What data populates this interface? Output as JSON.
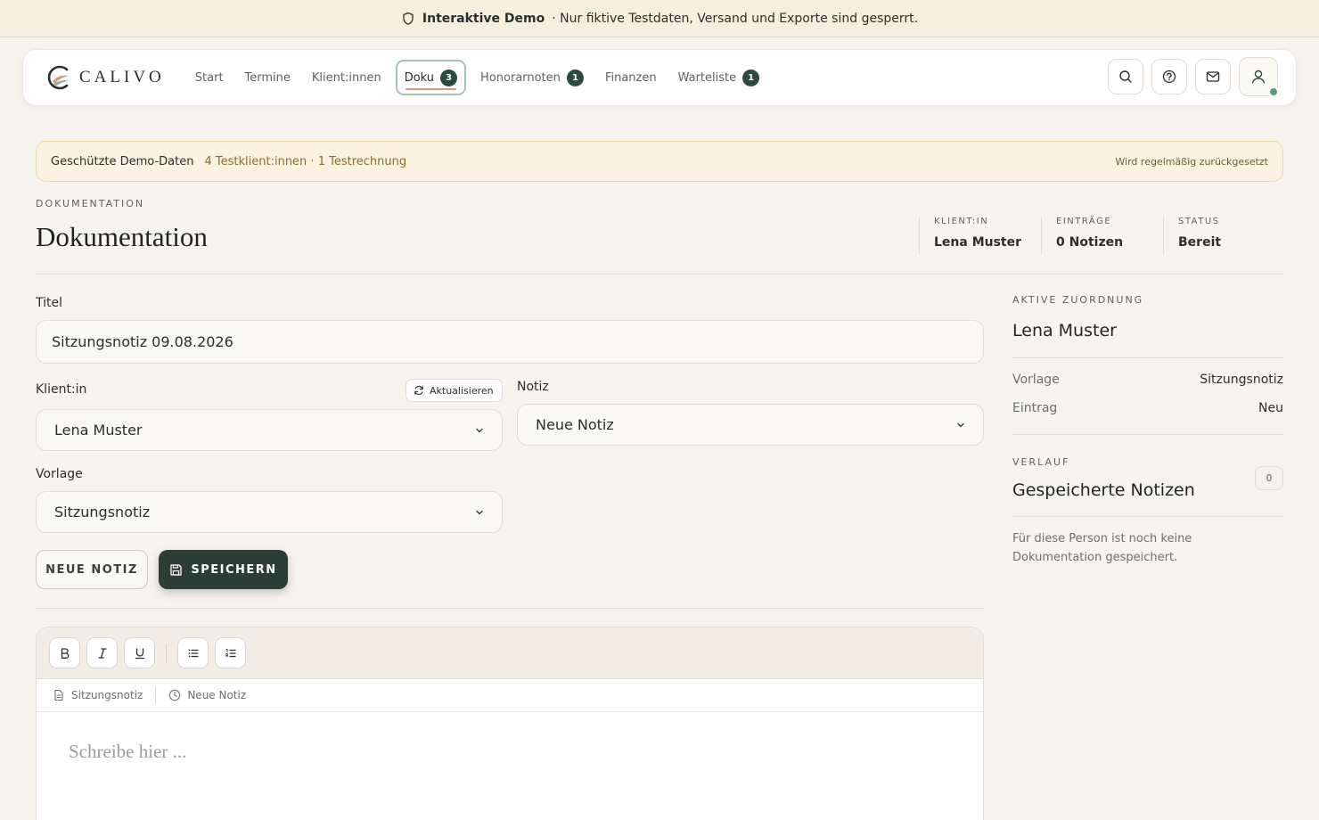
{
  "banner": {
    "title": "Interaktive Demo",
    "message": "· Nur fiktive Testdaten, Versand und Exporte sind gesperrt."
  },
  "nav": {
    "brand": "CALIVO",
    "links": [
      {
        "label": "Start",
        "badge": null
      },
      {
        "label": "Termine",
        "badge": null
      },
      {
        "label": "Klient:innen",
        "badge": null
      },
      {
        "label": "Doku",
        "badge": "3",
        "active": true
      },
      {
        "label": "Honorarnoten",
        "badge": "1"
      },
      {
        "label": "Finanzen",
        "badge": null
      },
      {
        "label": "Warteliste",
        "badge": "1"
      }
    ],
    "actions": [
      "search-icon",
      "help-icon",
      "mail-icon",
      "user-icon"
    ]
  },
  "demo_strip": {
    "title": "Geschützte Demo-Daten",
    "info": "4 Testklient:innen · 1 Testrechnung",
    "note": "Wird regelmäßig zurückgesetzt"
  },
  "header": {
    "eyebrow": "DOKUMENTATION",
    "title": "Dokumentation",
    "stats": [
      {
        "label": "KLIENT:IN",
        "value": "Lena Muster"
      },
      {
        "label": "EINTRÄGE",
        "value": "0 Notizen"
      },
      {
        "label": "STATUS",
        "value": "Bereit"
      }
    ]
  },
  "form": {
    "title_label": "Titel",
    "title_value": "Sitzungsnotiz 09.08.2026",
    "client_label": "Klient:in",
    "refresh_label": "Aktualisieren",
    "client_value": "Lena Muster",
    "note_label": "Notiz",
    "note_value": "Neue Notiz",
    "template_label": "Vorlage",
    "template_value": "Sitzungsnotiz",
    "new_note_button": "NEUE NOTIZ",
    "save_button": "SPEICHERN"
  },
  "editor": {
    "tools": [
      "bold-icon",
      "italic-icon",
      "underline-icon",
      "bullet-list-icon",
      "numbered-list-icon"
    ],
    "meta_template": "Sitzungsnotiz",
    "meta_entry": "Neue Notiz",
    "placeholder": "Schreibe hier ..."
  },
  "sidebar": {
    "assignment_eyebrow": "AKTIVE ZUORDNUNG",
    "assignment_name": "Lena Muster",
    "rows": [
      {
        "key": "Vorlage",
        "value": "Sitzungsnotiz"
      },
      {
        "key": "Eintrag",
        "value": "Neu"
      }
    ],
    "history_eyebrow": "VERLAUF",
    "history_title": "Gespeicherte Notizen",
    "history_count": "0",
    "empty_text": "Für diese Person ist noch keine Dokumentation gespeichert."
  },
  "colors": {
    "accent": "#2c4a3e",
    "primary_button": "#2c3d35",
    "banner_bg": "#f6efe0",
    "online": "#5f9a7f"
  }
}
